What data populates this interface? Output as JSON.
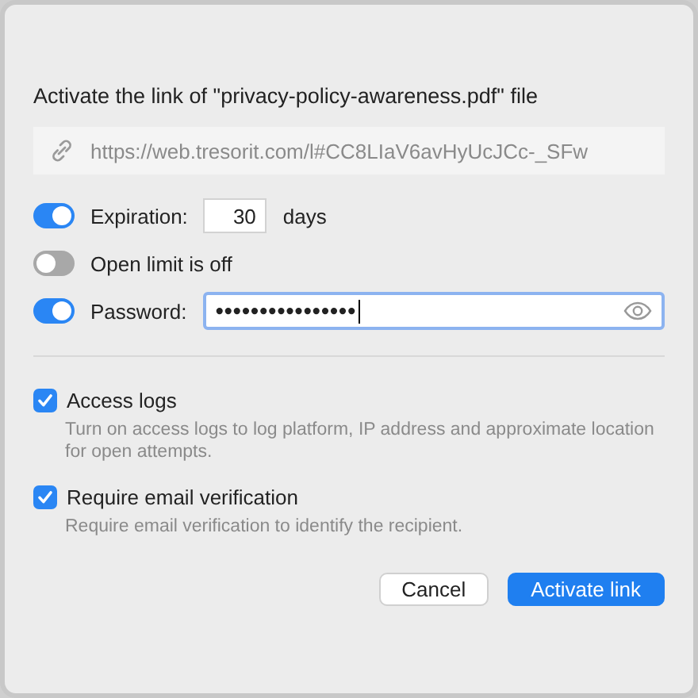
{
  "dialog": {
    "title": "Activate the link of \"privacy-policy-awareness.pdf\" file",
    "link": "https://web.tresorit.com/l#CC8LIaV6avHyUcJCc-_SFw",
    "toggles": [
      {
        "kind": "number",
        "on": true,
        "label": "Expiration:",
        "value": "30",
        "unit": "days"
      },
      {
        "kind": "plain",
        "on": false,
        "label": "Open limit is off"
      },
      {
        "kind": "password",
        "on": true,
        "label": "Password:",
        "value": "••••••••••••••••"
      }
    ],
    "options": [
      {
        "checked": true,
        "label": "Access logs",
        "description": "Turn on access logs to log platform, IP address and approximate location for open attempts."
      },
      {
        "checked": true,
        "label": "Require email verification",
        "description": "Require email verification to identify the recipient."
      }
    ],
    "buttons": [
      {
        "kind": "secondary",
        "label": "Cancel"
      },
      {
        "kind": "primary",
        "label": "Activate link"
      }
    ]
  }
}
